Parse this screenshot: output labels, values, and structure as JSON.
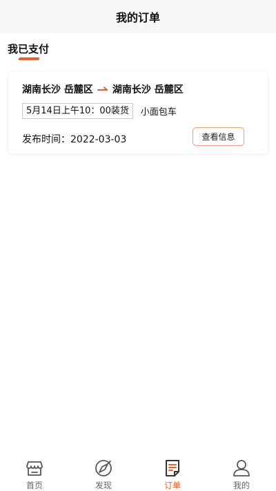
{
  "header": {
    "title": "我的订单"
  },
  "tabs": [
    {
      "label": "我已支付",
      "active": true
    }
  ],
  "colors": {
    "accent": "#e8602a",
    "header_bg": "#f7f7f7",
    "button_border": "#e8a07c"
  },
  "order": {
    "from": "湖南长沙 岳麓区",
    "to": "湖南长沙 岳麓区",
    "route_icon": "arrow-right-icon",
    "load_time": "5月14日上午10：00装货",
    "vehicle": "小面包车",
    "publish_label": "发布时间：",
    "publish_date": "2022-03-03",
    "view_button": "查看信息"
  },
  "bottom_nav": [
    {
      "label": "首页",
      "icon": "store-icon",
      "active": false
    },
    {
      "label": "发现",
      "icon": "compass-icon",
      "active": false
    },
    {
      "label": "订单",
      "icon": "order-list-icon",
      "active": true
    },
    {
      "label": "我的",
      "icon": "user-icon",
      "active": false
    }
  ]
}
